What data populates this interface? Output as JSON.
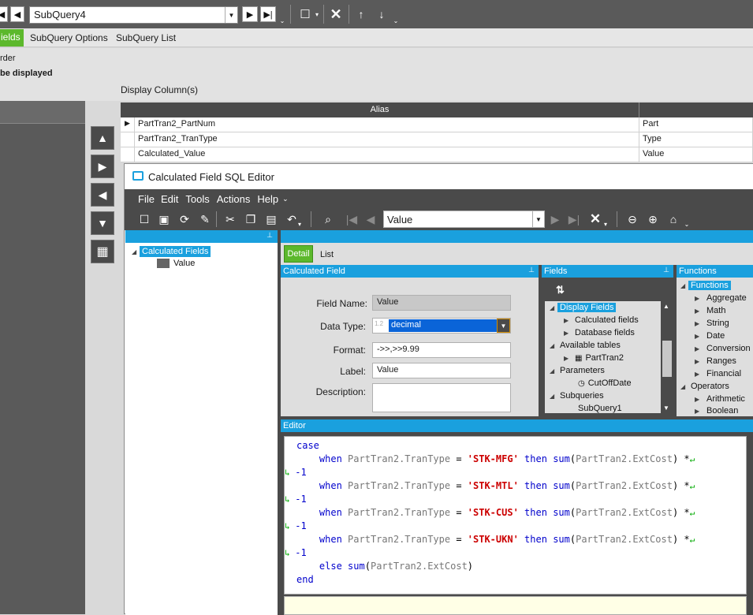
{
  "toolbar": {
    "subquery_value": "SubQuery4"
  },
  "tabs": {
    "fields": "ields",
    "subquery_options": "SubQuery Options",
    "subquery_list": "SubQuery List"
  },
  "section": {
    "order_label": "rder",
    "be_displayed": "be displayed",
    "display_columns": "Display Column(s)"
  },
  "grid": {
    "alias_header": "Alias",
    "rows": [
      {
        "field": "PartTran2_PartNum",
        "alias": "Part"
      },
      {
        "field": "PartTran2_TranType",
        "alias": "Type"
      },
      {
        "field": "Calculated_Value",
        "alias": "Value"
      }
    ]
  },
  "dialog": {
    "title": "Calculated Field SQL Editor",
    "menu": [
      "File",
      "Edit",
      "Tools",
      "Actions",
      "Help"
    ],
    "combo_value": "Value",
    "left_tree": {
      "root": "Calculated Fields",
      "child": "Value"
    },
    "tabs": {
      "detail": "Detail",
      "list": "List"
    },
    "calc_header": "Calculated Field",
    "form": {
      "field_name_label": "Field Name:",
      "field_name_value": "Value",
      "data_type_label": "Data Type:",
      "data_type_value": "decimal",
      "format_label": "Format:",
      "format_value": "->>,>>9.99",
      "label_label": "Label:",
      "label_value": "Value",
      "description_label": "Description:",
      "description_value": ""
    },
    "fields_panel": {
      "header": "Fields",
      "items": {
        "display_fields": "Display Fields",
        "calculated_fields": "Calculated fields",
        "database_fields": "Database fields",
        "available_tables": "Available tables",
        "parttran2": "PartTran2",
        "parameters": "Parameters",
        "cutoffdate": "CutOffDate",
        "subqueries": "Subqueries",
        "subquery1": "SubQuery1"
      }
    },
    "functions_panel": {
      "header": "Functions",
      "items": {
        "functions": "Functions",
        "aggregate": "Aggregate",
        "math": "Math",
        "string": "String",
        "date": "Date",
        "conversion": "Conversion",
        "ranges": "Ranges",
        "financial": "Financial",
        "operators": "Operators",
        "arithmetic": "Arithmetic",
        "boolean": "Boolean"
      }
    },
    "editor_header": "Editor",
    "code": {
      "case": "case",
      "when": "when",
      "then": "then",
      "sum": "sum",
      "else": "else",
      "end": "end",
      "col_type": "PartTran2.TranType",
      "col_cost": "PartTran2.ExtCost",
      "eq": " = ",
      "mult": " *",
      "neg1": "-1",
      "s1": "'STK-MFG'",
      "s2": "'STK-MTL'",
      "s3": "'STK-CUS'",
      "s4": "'STK-UKN'"
    }
  },
  "icons": [
    "save-icon",
    "refresh-icon",
    "clear-icon",
    "cut-icon",
    "copy-icon",
    "paste-icon",
    "undo-icon",
    "search-icon",
    "calculator-icon"
  ],
  "colors": {
    "accent": "#1aa0de",
    "tab_active": "#5cb82c",
    "toolbar": "#4a4a4a"
  }
}
